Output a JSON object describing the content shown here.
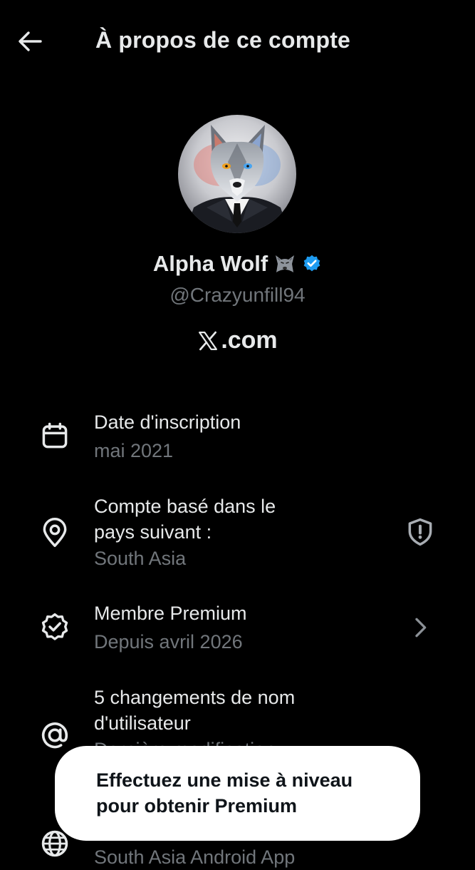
{
  "header": {
    "title": "À propos de ce compte",
    "back_icon": "arrow-left-icon"
  },
  "profile": {
    "display_name": "Alpha Wolf",
    "name_emoji": "wolf-emoji",
    "verified_icon": "verified-badge-icon",
    "handle": "@Crazyunfill94",
    "site_label": ".com",
    "site_logo": "x-logo-icon"
  },
  "info_items": [
    {
      "icon": "calendar-icon",
      "title": "Date d'inscription",
      "subtitle": "mai 2021"
    },
    {
      "icon": "location-pin-icon",
      "title_line1": "Compte basé dans le",
      "title_line2": "pays suivant :",
      "subtitle": "South Asia",
      "trailing_icon": "shield-alert-icon"
    },
    {
      "icon": "premium-badge-icon",
      "title": "Membre Premium",
      "subtitle": "Depuis avril 2026",
      "trailing_icon": "chevron-right-icon"
    },
    {
      "icon": "at-sign-icon",
      "title_line1": "5 changements de nom",
      "title_line2": "d'utilisateur",
      "subtitle": "Dernière modification"
    },
    {
      "icon": "globe-icon",
      "subtitle": "South Asia Android App"
    }
  ],
  "toast": {
    "line1": "Effectuez une mise à niveau",
    "line2": "pour obtenir Premium"
  },
  "colors": {
    "background": "#000000",
    "primary_text": "#e7e9ea",
    "secondary_text": "#71767b",
    "verified_blue": "#1d9bf0",
    "toast_background": "#ffffff"
  }
}
